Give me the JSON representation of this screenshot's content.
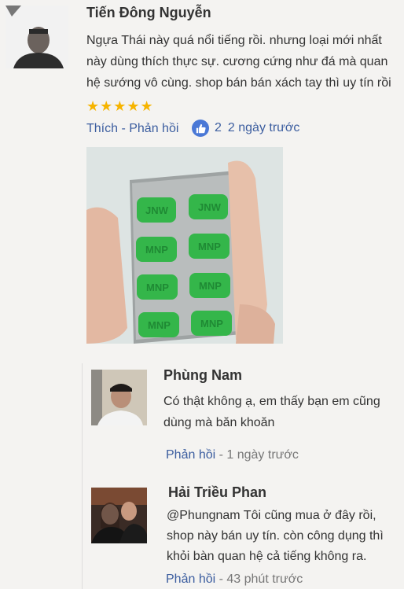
{
  "main_comment": {
    "author": "Tiến Đông Nguyễn",
    "body": "Ngựa Thái này quá nổi tiếng rồi. nhưng loại mới nhất này dùng thích thực sự. cương cứng như đá mà quan hệ sướng vô cùng. shop bán bán xách tay thì uy tín rồi",
    "rating_stars": "★★★★★",
    "rating_value": 5,
    "like_label": "Thích",
    "separator": " - ",
    "reply_label": "Phản hồi",
    "like_count": "2",
    "time": "2 ngày trước",
    "photo_pill_text": "JNW",
    "photo_pill_text_alt": "MNP"
  },
  "replies": [
    {
      "author": "Phùng Nam",
      "text": "Có thật không ạ, em thấy bạn em cũng dùng mà băn khoăn",
      "reply_label": "Phản hồi",
      "separator": " - ",
      "time": "1 ngày trước"
    },
    {
      "author": "Hải Triều Phan",
      "text": "@Phungnam Tôi cũng mua ở đây rồi, shop này bán uy tín. còn công dụng thì khỏi bàn quan hệ cả tiếng không ra.",
      "reply_label": "Phản hồi",
      "separator": " - ",
      "time": "43 phút trước"
    }
  ],
  "colors": {
    "link": "#3b5d9f",
    "star": "#f6b400",
    "pill_green": "#34b64a",
    "like_blue": "#4a78d6"
  }
}
